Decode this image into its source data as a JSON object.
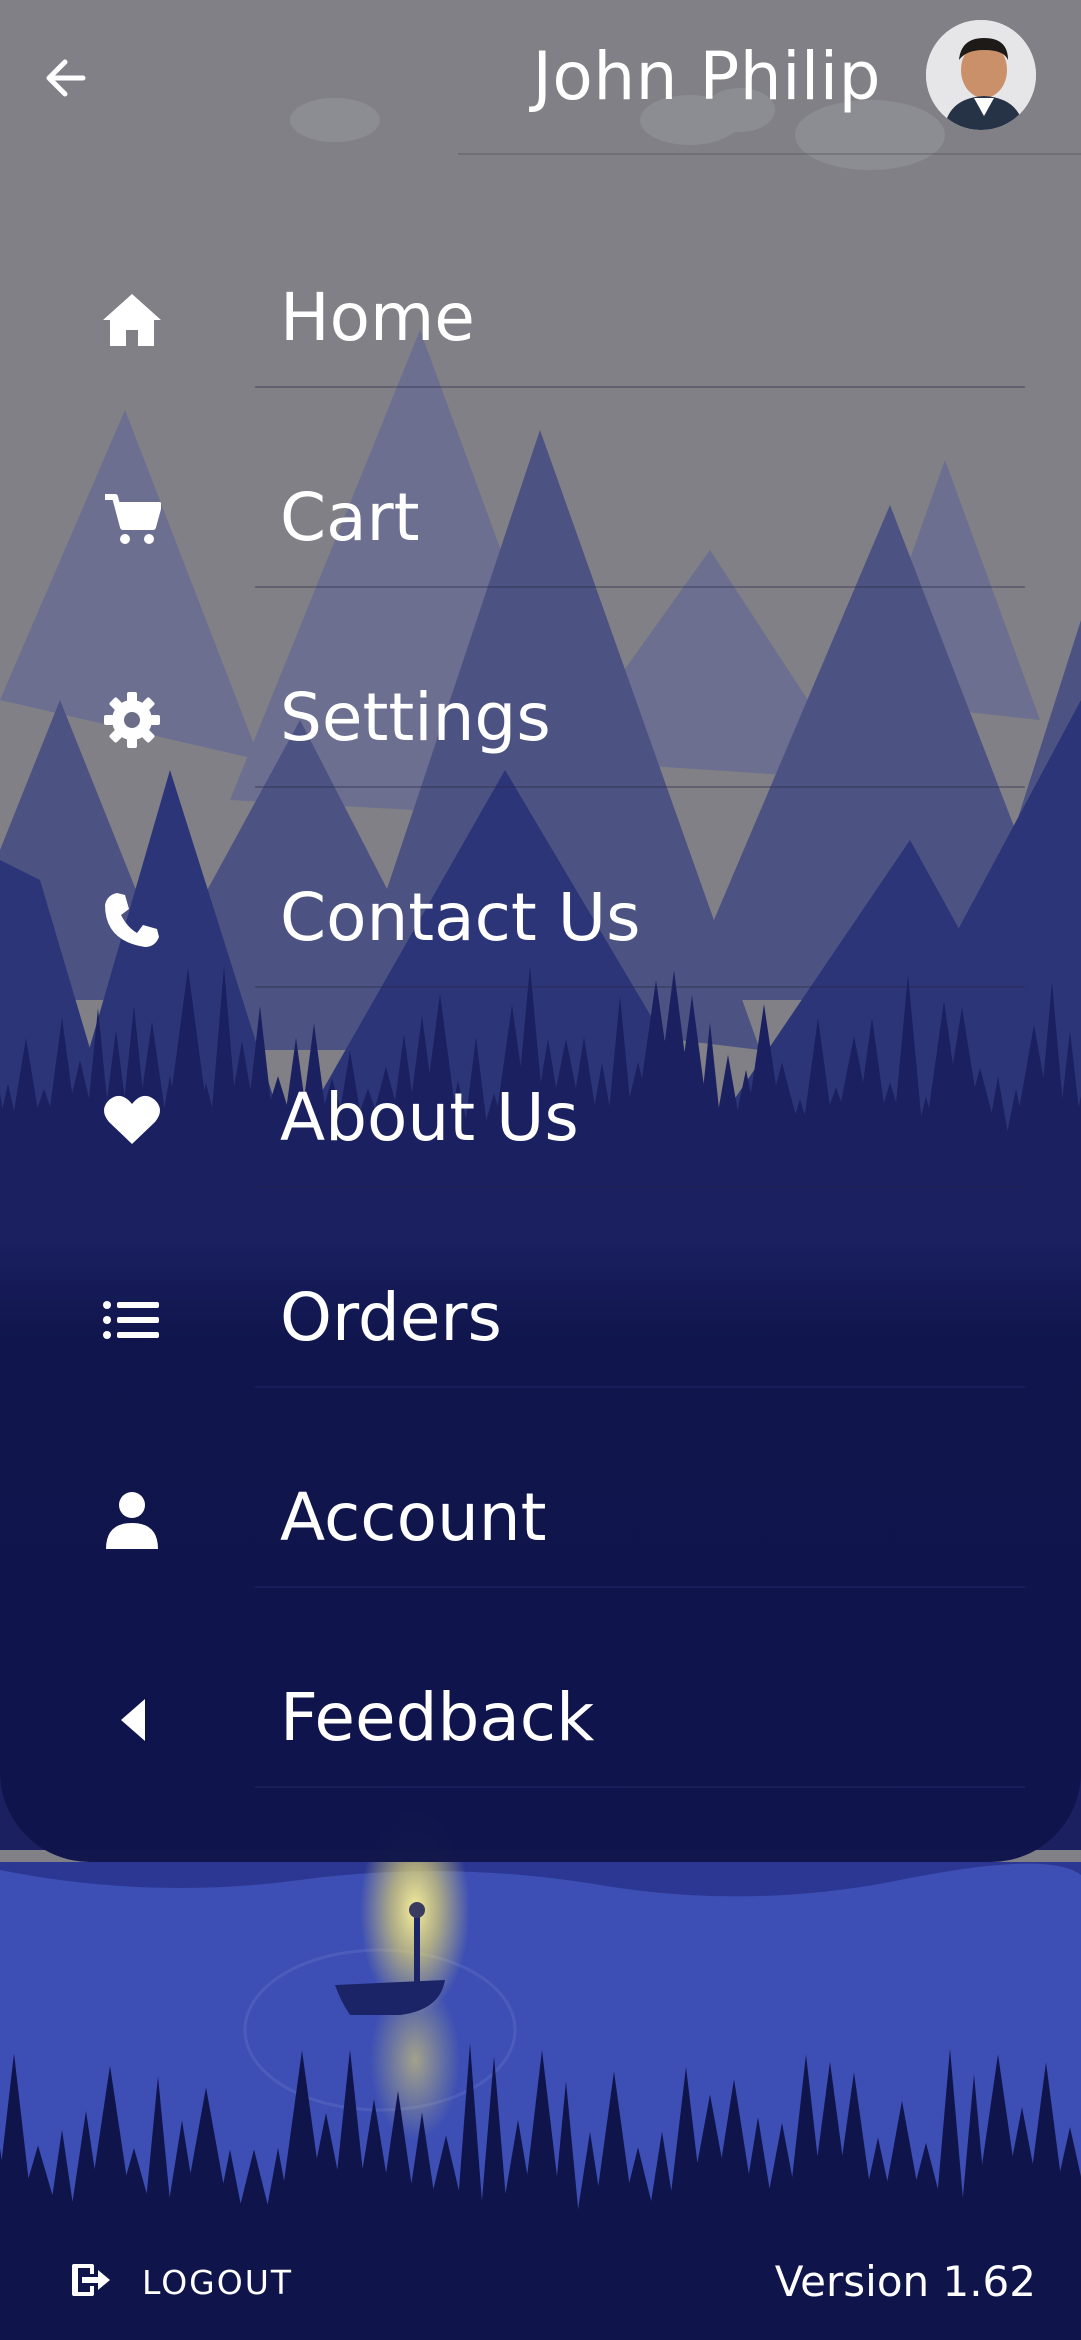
{
  "header": {
    "user_name": "John Philip",
    "back_icon": "arrow-left-icon",
    "avatar_icon": "user-avatar-photo"
  },
  "menu": {
    "items": [
      {
        "label": "Home",
        "icon": "home-icon"
      },
      {
        "label": "Cart",
        "icon": "cart-icon"
      },
      {
        "label": "Settings",
        "icon": "gear-icon"
      },
      {
        "label": "Contact Us",
        "icon": "phone-icon"
      },
      {
        "label": "About Us",
        "icon": "heart-icon"
      },
      {
        "label": "Orders",
        "icon": "list-icon"
      },
      {
        "label": "Account",
        "icon": "person-icon"
      },
      {
        "label": "Feedback",
        "icon": "caret-left-icon"
      }
    ]
  },
  "footer": {
    "logout_label": "LOGOUT",
    "logout_icon": "logout-icon",
    "version": "Version 1.62"
  },
  "colors": {
    "sky": "#808086",
    "mountain_far": "#646890",
    "mountain_mid": "#4a5080",
    "forest_dark": "#0f144b",
    "lake": "#3d4fb4",
    "lantern_glow": "#f5e66a",
    "text": "#ffffff"
  }
}
